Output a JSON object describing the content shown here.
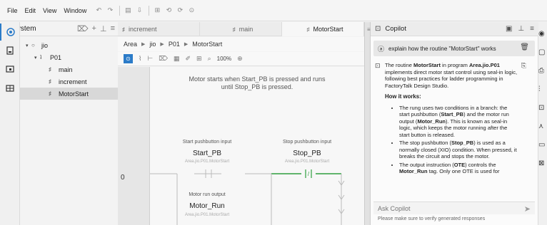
{
  "menubar": {
    "items": [
      "File",
      "Edit",
      "View",
      "Window"
    ]
  },
  "system": {
    "title": "System",
    "tree": [
      {
        "label": "jio",
        "toggle": "▾",
        "icon": "○"
      },
      {
        "label": "P01",
        "toggle": "▾",
        "icon": "ʇ"
      },
      {
        "label": "main",
        "icon": "♯"
      },
      {
        "label": "increment",
        "icon": "♯"
      },
      {
        "label": "MotorStart",
        "icon": "♯"
      }
    ]
  },
  "editor": {
    "tabs": [
      "increment",
      "main",
      "MotorStart"
    ],
    "breadcrumb": [
      "Area",
      "jio",
      "P01",
      "MotorStart"
    ],
    "zoom": "100%",
    "rung": {
      "number": "0",
      "comment": "Motor starts when Start_PB is pressed and runs until Stop_PB is pressed.",
      "start": {
        "label": "Start pushbutton input",
        "tag": "Start_PB",
        "path": "Area.jio.P01.MotorStart"
      },
      "stop": {
        "label": "Stop pushbutton input",
        "tag": "Stop_PB",
        "path": "Area.jio.P01.MotorStart",
        "symbol": "/"
      },
      "output": {
        "label": "Motor run output",
        "tag": "Motor_Run",
        "path": "Area.jio.P01.MotorStart"
      }
    }
  },
  "copilot": {
    "title": "Copilot",
    "user_message": "explain how the routine \"MotorStart\" works",
    "reply": {
      "intro_parts": [
        "The routine ",
        "MotorStart",
        " in program ",
        "Area.jio.P01",
        " implements direct motor start control using seal-in logic, following best practices for ladder programming in FactoryTalk Design Studio."
      ],
      "heading": "How it works:",
      "bullets": [
        {
          "parts": [
            "The rung uses two conditions in a branch: the start pushbutton (",
            "Start_PB",
            ") and the motor run output (",
            "Motor_Run",
            "). This is known as seal-in logic, which keeps the motor running after the start button is released."
          ]
        },
        {
          "parts": [
            "The stop pushbutton (",
            "Stop_PB",
            ") is used as a normally closed (XIO) condition. When pressed, it breaks the circuit and stops the motor."
          ]
        },
        {
          "parts": [
            "The output instruction (",
            "OTE",
            ") controls the ",
            "Motor_Run",
            " tag. Only one OTE is used for"
          ]
        }
      ]
    },
    "ask_placeholder": "Ask Copilot",
    "disclaimer": "Please make sure to verify generated responses"
  }
}
